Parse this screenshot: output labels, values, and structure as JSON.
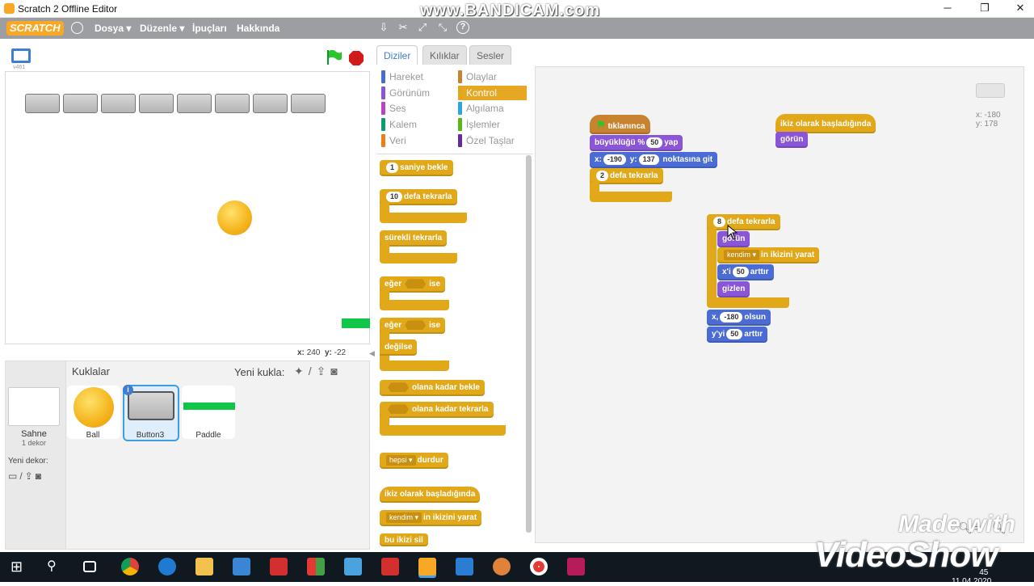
{
  "window": {
    "title": "Scratch 2 Offline Editor",
    "watermark": "www.BANDICAM.com"
  },
  "menu": {
    "logo": "SCRATCH",
    "items": [
      "Dosya",
      "Düzenle",
      "İpuçları",
      "Hakkında"
    ]
  },
  "stage": {
    "version": "v461",
    "coords": {
      "x_label": "x:",
      "x": "240",
      "y_label": "y:",
      "y": "-22"
    }
  },
  "sprites": {
    "title": "Kuklalar",
    "new_sprite": "Yeni kukla:",
    "stage_label": "Sahne",
    "stage_sub": "1 dekor",
    "new_backdrop": "Yeni dekor:",
    "items": [
      {
        "name": "Ball"
      },
      {
        "name": "Button3",
        "selected": true
      },
      {
        "name": "Paddle"
      }
    ]
  },
  "tabs": [
    "Diziler",
    "Kılıklar",
    "Sesler"
  ],
  "categories": {
    "left": [
      "Hareket",
      "Görünüm",
      "Ses",
      "Kalem",
      "Veri"
    ],
    "right": [
      "Olaylar",
      "Kontrol",
      "Algılama",
      "İşlemler",
      "Özel Taşlar"
    ],
    "active": "Kontrol",
    "colors": {
      "Hareket": "#4a6cd4",
      "Görünüm": "#8a55d7",
      "Ses": "#bb42c3",
      "Kalem": "#0e9a6c",
      "Veri": "#ee7d16",
      "Olaylar": "#c88330",
      "Kontrol": "#e1a91a",
      "Algılama": "#2ca5e2",
      "İşlemler": "#5cb712",
      "Özel Taşlar": "#632d99"
    }
  },
  "palette": {
    "wait": {
      "n": "1",
      "text": "saniye bekle"
    },
    "repeat": {
      "n": "10",
      "text": "defa tekrarla"
    },
    "forever": "sürekli tekrarla",
    "if_then": {
      "a": "eğer",
      "b": "ise"
    },
    "if_else": {
      "a": "eğer",
      "b": "ise",
      "c": "değilse"
    },
    "wait_until": "olana kadar bekle",
    "repeat_until": "olana kadar tekrarla",
    "stop": {
      "opt": "hepsi",
      "text": "durdur"
    },
    "clone_start": "ikiz olarak başladığında",
    "create_clone": {
      "opt": "kendim",
      "text": "in ikizini yarat"
    },
    "delete_clone": "bu ikizi sil"
  },
  "script1": {
    "hat": "tıklanınca",
    "size": {
      "a": "büyüklüğü %",
      "v": "50",
      "b": "yap"
    },
    "goto": {
      "x_label": "x:",
      "x": "-190",
      "y_label": "y:",
      "y": "137",
      "text": "noktasına git"
    },
    "repeat": {
      "n": "2",
      "text": "defa tekrarla"
    }
  },
  "script2": {
    "hat": "ikiz olarak başladığında",
    "show": "görün"
  },
  "script3": {
    "repeat": {
      "n": "8",
      "text": "defa tekrarla"
    },
    "show": "görün",
    "clone": {
      "opt": "kendim",
      "text": "in ikizini yarat"
    },
    "changex": {
      "a": "x'i",
      "v": "50",
      "b": "arttır"
    },
    "hide": "gizlen",
    "setx": {
      "a": "x,",
      "v": "-180",
      "b": "olsun"
    },
    "changey": {
      "a": "y'yi",
      "v": "50",
      "b": "arttır"
    }
  },
  "script_area": {
    "x_readout": "x: -180",
    "y_readout": "y: 178"
  },
  "taskbar": {
    "time": "45",
    "date": "11.04.2020"
  },
  "overlay": {
    "madewith": "Made with",
    "brand": "VideoShow"
  }
}
